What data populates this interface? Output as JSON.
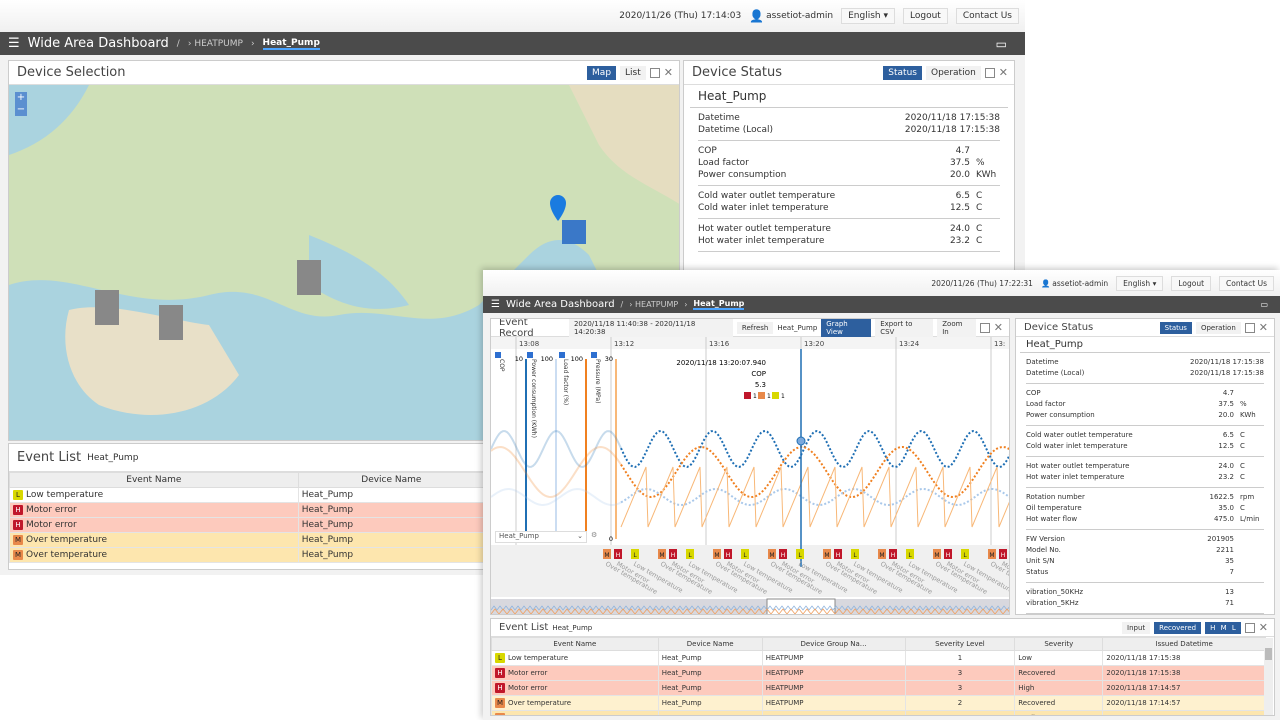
{
  "back": {
    "header": {
      "datetime": "2020/11/26 (Thu) 17:14:03",
      "user": "assetiot-admin",
      "language": "English",
      "logout": "Logout",
      "contact": "Contact Us"
    },
    "nav": {
      "title": "Wide Area Dashboard",
      "sep": "/",
      "crumbs": [
        "HEATPUMP",
        "Heat_Pump"
      ]
    },
    "device_selection": {
      "title": "Device Selection",
      "map_btn": "Map",
      "list_btn": "List",
      "zoom_in": "+",
      "zoom_out": "−"
    },
    "device_status": {
      "title": "Device Status",
      "status_btn": "Status",
      "operation_btn": "Operation",
      "device": "Heat_Pump",
      "groups": [
        [
          [
            "Datetime",
            "2020/11/18 17:15:38",
            ""
          ],
          [
            "Datetime (Local)",
            "2020/11/18 17:15:38",
            ""
          ]
        ],
        [
          [
            "COP",
            "4.7",
            ""
          ],
          [
            "Load factor",
            "37.5",
            "%"
          ],
          [
            "Power consumption",
            "20.0",
            "KWh"
          ]
        ],
        [
          [
            "Cold water outlet temperature",
            "6.5",
            "C"
          ],
          [
            "Cold water inlet temperature",
            "12.5",
            "C"
          ]
        ],
        [
          [
            "Hot water outlet temperature",
            "24.0",
            "C"
          ],
          [
            "Hot water inlet temperature",
            "23.2",
            "C"
          ]
        ]
      ]
    },
    "event_list": {
      "title": "Event List",
      "device": "Heat_Pump",
      "columns": [
        "Event Name",
        "Device Name"
      ],
      "rows": [
        [
          "L",
          "Low temperature",
          "Heat_Pump"
        ],
        [
          "H",
          "Motor error",
          "Heat_Pump"
        ],
        [
          "H",
          "Motor error",
          "Heat_Pump"
        ],
        [
          "M",
          "Over temperature",
          "Heat_Pump"
        ],
        [
          "M",
          "Over temperature",
          "Heat_Pump"
        ]
      ]
    }
  },
  "front": {
    "header": {
      "datetime": "2020/11/26 (Thu) 17:22:31",
      "user": "assetiot-admin",
      "language": "English",
      "logout": "Logout",
      "contact": "Contact Us"
    },
    "nav": {
      "title": "Wide Area Dashboard",
      "sep": "/",
      "crumbs": [
        "HEATPUMP",
        "Heat_Pump"
      ]
    },
    "event_record": {
      "title": "Event Record",
      "range": "2020/11/18 11:40:38 - 2020/11/18 14:20:38",
      "refresh": "Refresh",
      "device": "Heat_Pump",
      "graph_view": "Graph View",
      "export": "Export to CSV",
      "zoom_in": "Zoom In",
      "time_ticks": [
        "13:08",
        "13:12",
        "13:16",
        "13:20",
        "13:24",
        "13:"
      ],
      "axes": [
        {
          "name": "COP",
          "max": "10",
          "min": "0",
          "color": "#1f6fb4"
        },
        {
          "name": "Power consumption (KWh)",
          "max": "100",
          "min": "0",
          "color": "#a9c8ea"
        },
        {
          "name": "Load factor (%)",
          "max": "100",
          "min": "0",
          "color": "#f08020"
        },
        {
          "name": "Pressure (MPa)",
          "max": "30",
          "min": "0",
          "color": "#f8b878"
        }
      ],
      "tooltip": {
        "time": "2020/11/18 13:20:07.940",
        "label": "COP",
        "value": "5.3",
        "counts": [
          [
            "H",
            "1"
          ],
          [
            "M",
            "1"
          ],
          [
            "L",
            "1"
          ]
        ]
      },
      "device_select": "Heat_Pump",
      "event_labels": [
        "Over temperature",
        "Motor error",
        "Low temperature"
      ],
      "event_badges": [
        "M",
        "H",
        "L"
      ]
    },
    "device_status": {
      "title": "Device Status",
      "status_btn": "Status",
      "operation_btn": "Operation",
      "device": "Heat_Pump",
      "groups": [
        [
          [
            "Datetime",
            "2020/11/18 17:15:38",
            ""
          ],
          [
            "Datetime (Local)",
            "2020/11/18 17:15:38",
            ""
          ]
        ],
        [
          [
            "COP",
            "4.7",
            ""
          ],
          [
            "Load factor",
            "37.5",
            "%"
          ],
          [
            "Power consumption",
            "20.0",
            "KWh"
          ]
        ],
        [
          [
            "Cold water outlet temperature",
            "6.5",
            "C"
          ],
          [
            "Cold water inlet temperature",
            "12.5",
            "C"
          ]
        ],
        [
          [
            "Hot water outlet temperature",
            "24.0",
            "C"
          ],
          [
            "Hot water inlet temperature",
            "23.2",
            "C"
          ]
        ],
        [
          [
            "Rotation number",
            "1622.5",
            "rpm"
          ],
          [
            "Oil temperature",
            "35.0",
            "C"
          ],
          [
            "Hot water flow",
            "475.0",
            "L/min"
          ]
        ],
        [
          [
            "FW Version",
            "201905",
            ""
          ],
          [
            "Model No.",
            "2211",
            ""
          ],
          [
            "Unit S/N",
            "35",
            ""
          ],
          [
            "Status",
            "7",
            ""
          ]
        ],
        [
          [
            "vibration_50KHz",
            "13",
            ""
          ],
          [
            "vibration_5KHz",
            "71",
            ""
          ]
        ]
      ]
    },
    "event_list": {
      "title": "Event List",
      "device": "Heat_Pump",
      "input": "Input",
      "recovered": "Recovered",
      "sev_filter": [
        "H",
        "M",
        "L"
      ],
      "columns": [
        "Event Name",
        "Device Name",
        "Device Group Na…",
        "Severity Level",
        "Severity",
        "Issued Datetime"
      ],
      "rows": [
        [
          "L",
          "Low temperature",
          "Heat_Pump",
          "HEATPUMP",
          "1",
          "Low",
          "2020/11/18 17:15:38"
        ],
        [
          "H",
          "Motor error",
          "Heat_Pump",
          "HEATPUMP",
          "3",
          "Recovered",
          "2020/11/18 17:15:38"
        ],
        [
          "H",
          "Motor error",
          "Heat_Pump",
          "HEATPUMP",
          "3",
          "High",
          "2020/11/18 17:14:57"
        ],
        [
          "M",
          "Over temperature",
          "Heat_Pump",
          "HEATPUMP",
          "2",
          "Recovered",
          "2020/11/18 17:14:57"
        ],
        [
          "M",
          "Over temperature",
          "Heat_Pump",
          "HEATPUMP",
          "2",
          "Medium",
          "2020/11/18 17:14:27"
        ]
      ]
    }
  }
}
